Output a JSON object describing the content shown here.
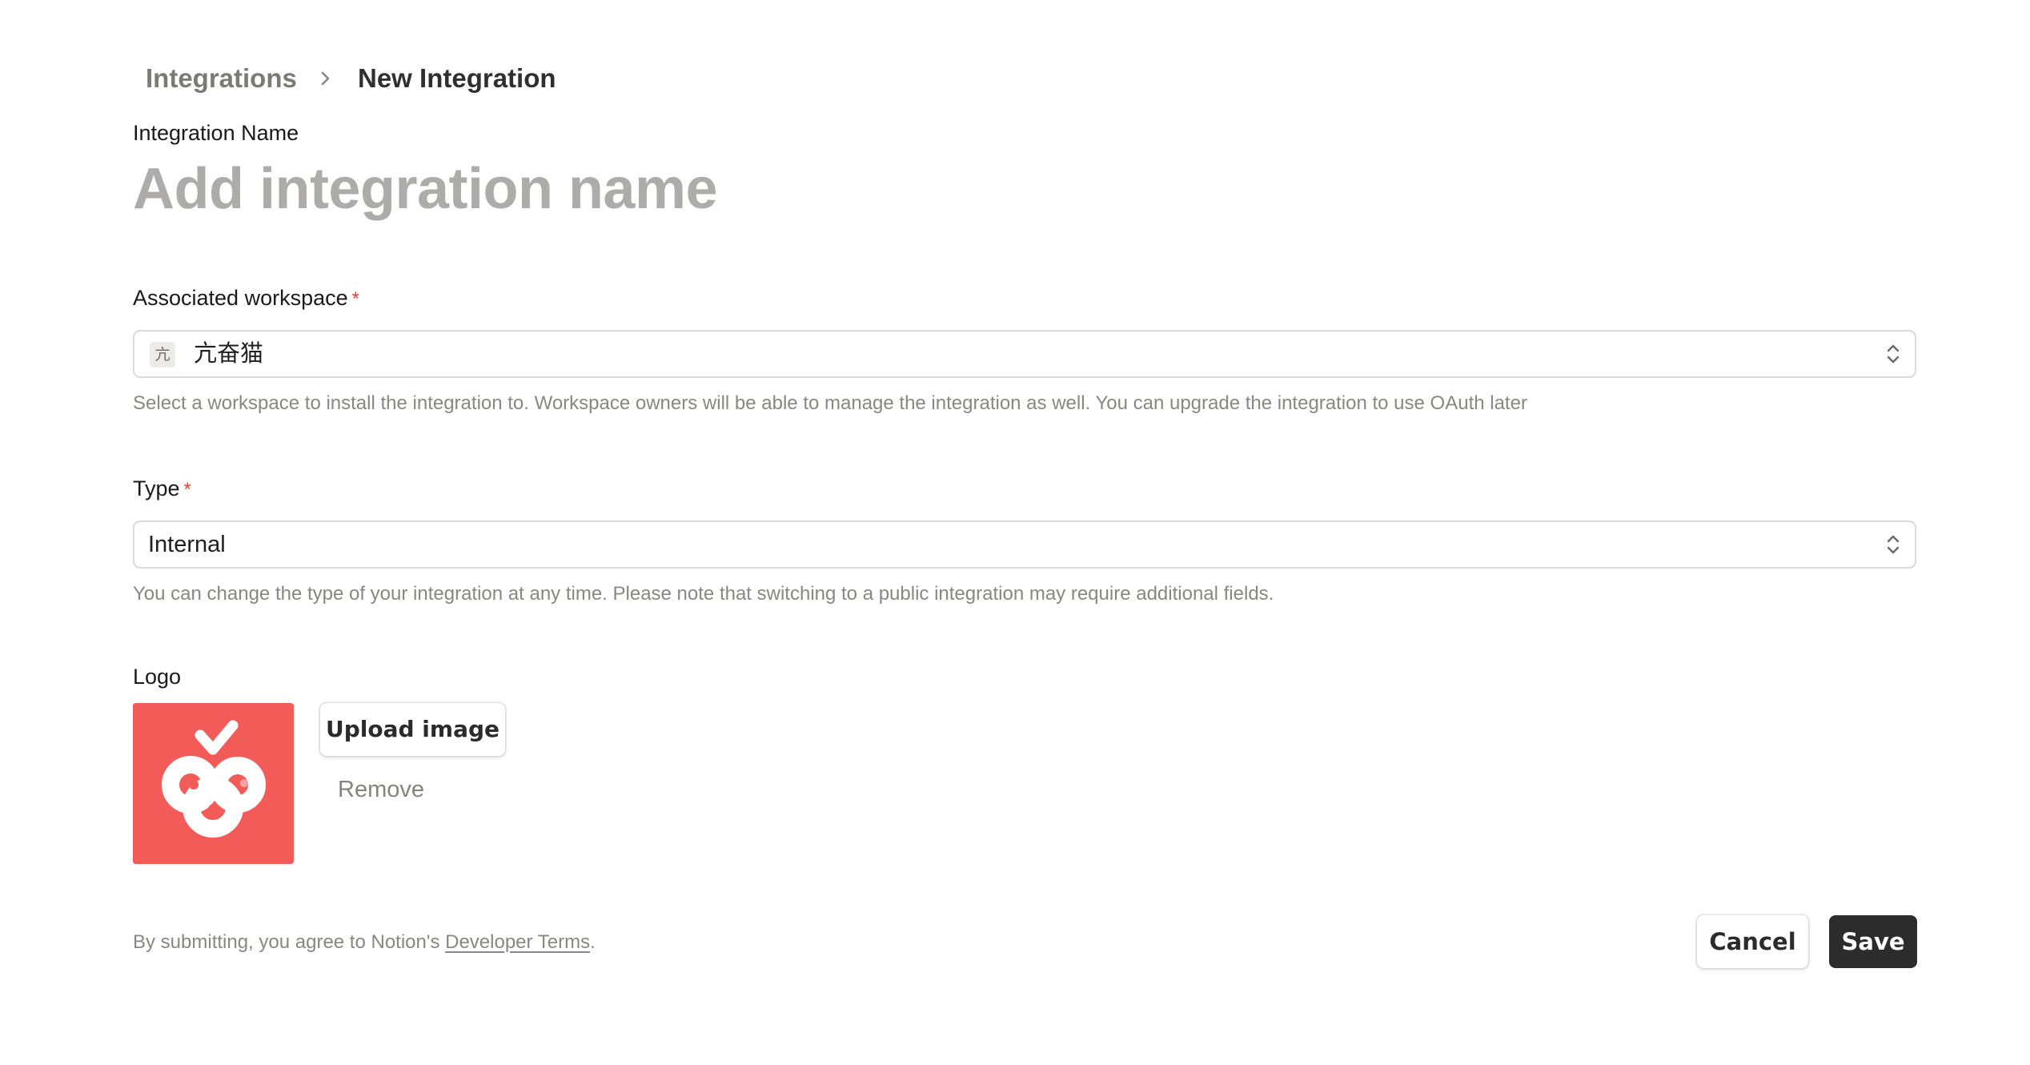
{
  "breadcrumb": {
    "parent": "Integrations",
    "current": "New Integration",
    "separator_icon": "chevron-right-icon"
  },
  "name_field": {
    "label": "Integration Name",
    "placeholder": "Add integration name",
    "value": ""
  },
  "workspace_field": {
    "label": "Associated workspace",
    "required_mark": "*",
    "badge_char": "亢",
    "value": "亢奋猫",
    "icon": "up-down-chevron-icon",
    "hint": "Select a workspace to install the integration to. Workspace owners will be able to manage the integration as well. You can upgrade the integration to use OAuth later"
  },
  "type_field": {
    "label": "Type",
    "required_mark": "*",
    "value": "Internal",
    "icon": "up-down-chevron-icon",
    "hint": "You can change the type of your integration at any time. Please note that switching to a public integration may require additional fields."
  },
  "logo_field": {
    "label": "Logo",
    "upload_label": "Upload image",
    "remove_label": "Remove",
    "logo_bg_color": "#f35b59"
  },
  "footer": {
    "terms_prefix": "By submitting, you agree to Notion's ",
    "terms_link": "Developer Terms",
    "terms_suffix": ".",
    "cancel_label": "Cancel",
    "save_label": "Save"
  },
  "colors": {
    "accent_required": "#e0443e",
    "save_bg": "#2c2c2c",
    "muted_text": "#8a8782"
  }
}
